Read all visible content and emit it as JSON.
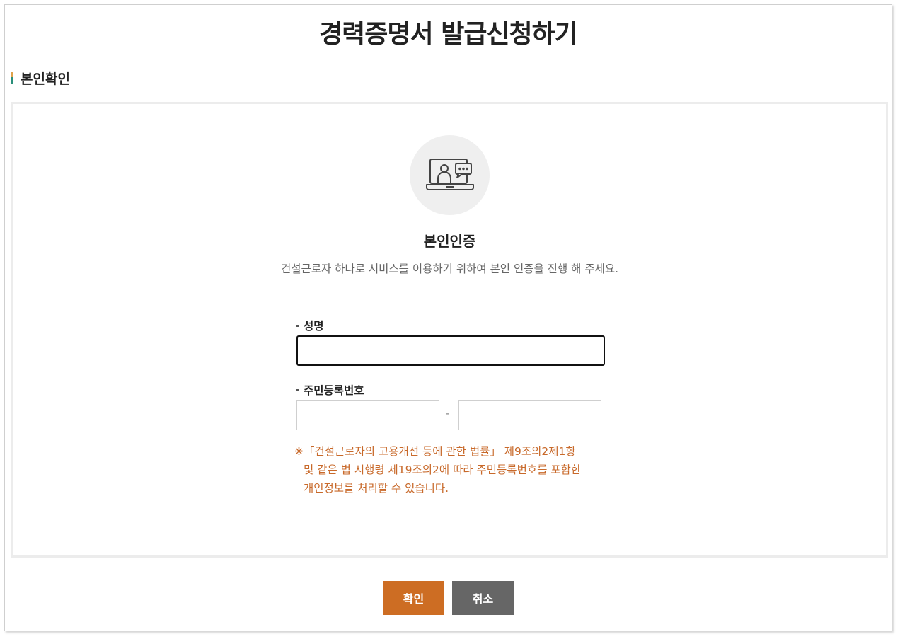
{
  "page": {
    "title": "경력증명서 발급신청하기"
  },
  "section": {
    "title": "본인확인"
  },
  "auth": {
    "icon": "laptop-video-chat-icon",
    "title": "본인인증",
    "description": "건설근로자 하나로 서비스를 이용하기 위하여 본인 인증을 진행 해 주세요."
  },
  "form": {
    "name_label": "성명",
    "name_value": "",
    "rrn_label": "주민등록번호",
    "rrn_front_value": "",
    "rrn_back_value": "",
    "rrn_separator": "-",
    "notice_lines": [
      "※「건설근로자의 고용개선 등에 관한 법률」 제9조의2제1항",
      "및 같은 법 시행령 제19조의2에 따라 주민등록번호를 포함한",
      "개인정보를 처리할 수 있습니다."
    ]
  },
  "buttons": {
    "confirm": "확인",
    "cancel": "취소"
  },
  "colors": {
    "accent": "#cd6d23",
    "cancel": "#666666",
    "notice": "#c8692a"
  }
}
